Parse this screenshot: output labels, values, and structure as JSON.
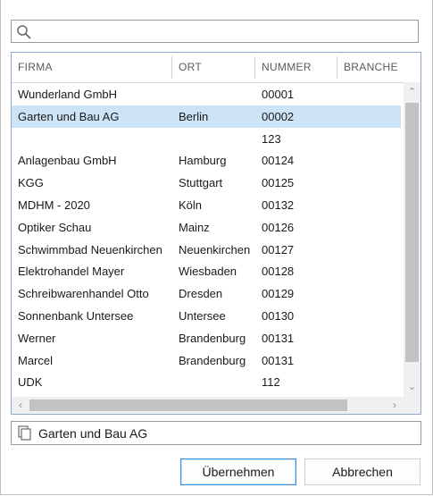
{
  "search": {
    "placeholder": "",
    "value": "",
    "icon": "search-icon"
  },
  "grid": {
    "columns": [
      "FIRMA",
      "ORT",
      "NUMMER",
      "BRANCHE"
    ],
    "rows": [
      {
        "firma": "Wunderland GmbH",
        "ort": "",
        "nummer": "00001",
        "branche": ""
      },
      {
        "firma": "Garten und Bau AG",
        "ort": "Berlin",
        "nummer": "00002",
        "branche": "",
        "selected": true
      },
      {
        "firma": "",
        "ort": "",
        "nummer": "123",
        "branche": ""
      },
      {
        "firma": "Anlagenbau GmbH",
        "ort": "Hamburg",
        "nummer": "00124",
        "branche": ""
      },
      {
        "firma": "KGG",
        "ort": "Stuttgart",
        "nummer": "00125",
        "branche": ""
      },
      {
        "firma": "MDHM - 2020",
        "ort": "Köln",
        "nummer": "00132",
        "branche": ""
      },
      {
        "firma": "Optiker Schau",
        "ort": "Mainz",
        "nummer": "00126",
        "branche": ""
      },
      {
        "firma": "Schwimmbad Neuenkirchen",
        "ort": "Neuenkirchen",
        "nummer": "00127",
        "branche": ""
      },
      {
        "firma": "Elektrohandel Mayer",
        "ort": "Wiesbaden",
        "nummer": "00128",
        "branche": ""
      },
      {
        "firma": "Schreibwarenhandel Otto",
        "ort": "Dresden",
        "nummer": "00129",
        "branche": ""
      },
      {
        "firma": "Sonnenbank Untersee",
        "ort": "Untersee",
        "nummer": "00130",
        "branche": ""
      },
      {
        "firma": "Werner",
        "ort": "Brandenburg",
        "nummer": "00131",
        "branche": ""
      },
      {
        "firma": "Marcel",
        "ort": "Brandenburg",
        "nummer": "00131",
        "branche": ""
      },
      {
        "firma": "UDK",
        "ort": "",
        "nummer": "112",
        "branche": ""
      }
    ]
  },
  "selection": {
    "value": "Garten und Bau AG",
    "icon": "copy-icon"
  },
  "buttons": {
    "ok_label": "Übernehmen",
    "cancel_label": "Abbrechen"
  },
  "colors": {
    "selected_row": "#cde4f7",
    "primary_border": "#3c8ede",
    "grid_border": "#8fa8c8"
  }
}
